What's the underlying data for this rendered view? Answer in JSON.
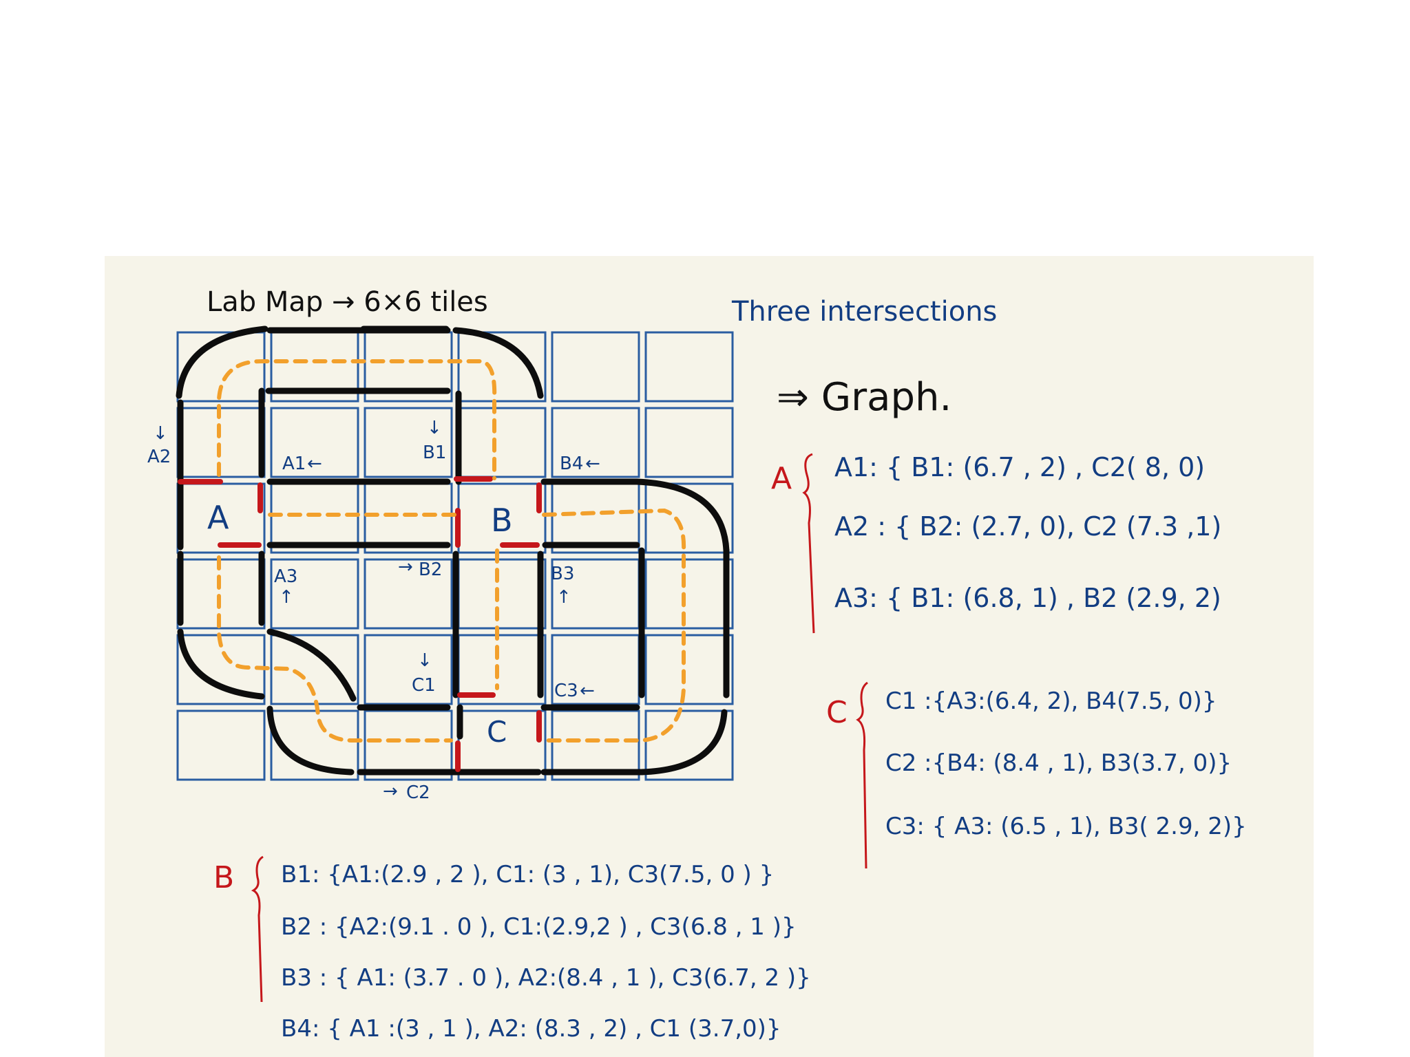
{
  "title": "Lab Map → 6×6 tiles",
  "heading": "Three intersections",
  "graph_label": "⇒ Graph.",
  "intersections": {
    "A": "A",
    "B": "B",
    "C": "C"
  },
  "map_labels": {
    "A2": "A2",
    "A1": "A1",
    "B1": "B1",
    "B4": "B4",
    "A3": "A3",
    "B2": "B2",
    "B3": "B3",
    "C1": "C1",
    "C3": "C3",
    "C2": "C2"
  },
  "group_a": {
    "letter": "A",
    "rows": [
      "A1: { B1: (6.7 , 2) , C2( 8, 0)",
      "A2 : { B2: (2.7, 0), C2 (7.3 ,1)",
      "A3: { B1: (6.8, 1) , B2 (2.9, 2)"
    ]
  },
  "group_c": {
    "letter": "C",
    "rows": [
      "C1 :{A3:(6.4, 2), B4(7.5, 0)}",
      "C2 :{B4: (8.4 , 1), B3(3.7, 0)}",
      "C3: { A3: (6.5 , 1), B3( 2.9, 2)}"
    ]
  },
  "group_b": {
    "letter": "B",
    "rows": [
      "B1: {A1:(2.9 , 2 ), C1: (3 , 1), C3(7.5, 0 ) }",
      "B2 : {A2:(9.1 . 0 ), C1:(2.9,2 ) , C3(6.8 , 1 )}",
      "B3 : { A1: (3.7 . 0 ), A2:(8.4 , 1 ), C3(6.7, 2 )}",
      "B4: { A1 :(3 , 1 ), A2: (8.3 , 2) , C1 (3.7,0)}"
    ]
  },
  "colors": {
    "paper": "#f6f4e9",
    "grid": "#2a5da1",
    "ink_blue": "#123d82",
    "ink_black": "#0d0d0d",
    "ink_red": "#c5171b",
    "path_orange": "#f2a02c"
  }
}
